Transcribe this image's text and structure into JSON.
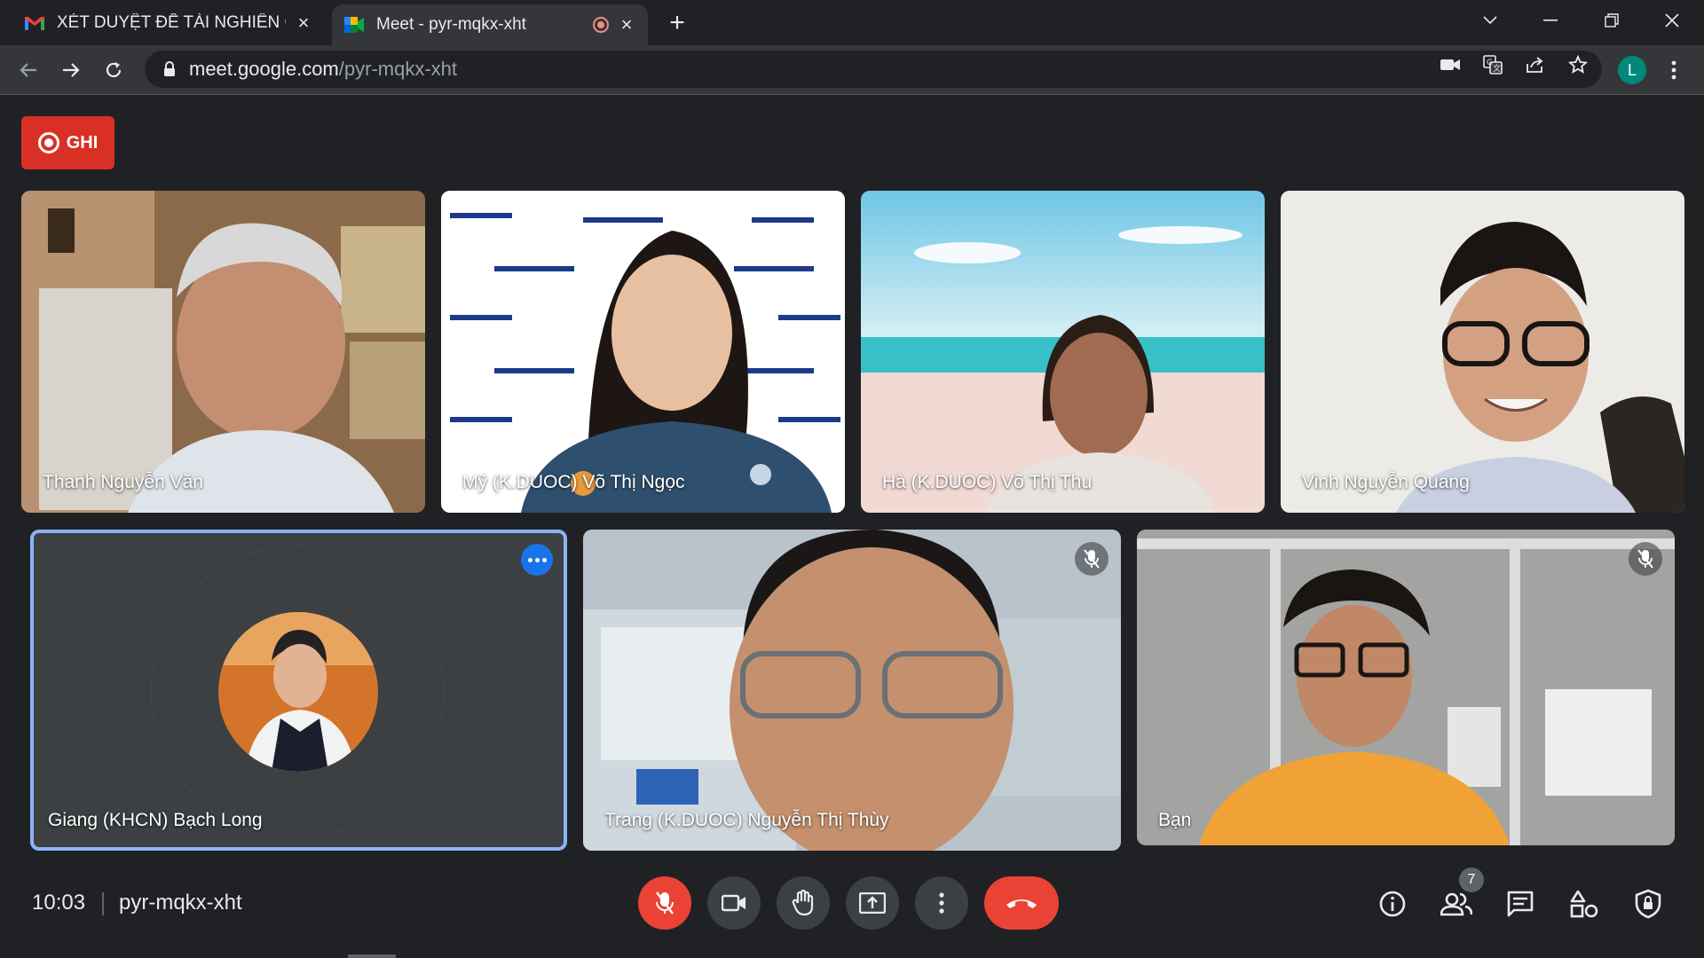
{
  "browser": {
    "tabs": [
      {
        "title": "XÉT DUYỆT ĐỀ TÀI NGHIÊN CỨU",
        "icon": "gmail-icon",
        "active": false
      },
      {
        "title": "Meet - pyr-mqkx-xht",
        "icon": "meet-icon",
        "active": true,
        "recording": true
      }
    ],
    "url_host": "meet.google.com",
    "url_path": "/pyr-mqkx-xht",
    "profile_initial": "L"
  },
  "meet": {
    "recording_label": "GHI",
    "participants": [
      {
        "name": "Thanh Nguyễn Văn",
        "muted": false
      },
      {
        "name": "Mỹ (K.DUOC) Võ Thị Ngọc",
        "muted": false
      },
      {
        "name": "Hà (K.DUOC) Võ Thị Thu",
        "muted": false
      },
      {
        "name": "Vinh Nguyễn Quang",
        "muted": false
      },
      {
        "name": "Giang (KHCN) Bạch Long",
        "muted": false,
        "speaking": true
      },
      {
        "name": "Trang (K.DUOC) Nguyễn Thị Thùy",
        "muted": true
      },
      {
        "name": "Bạn",
        "muted": true
      }
    ],
    "time": "10:03",
    "meeting_code": "pyr-mqkx-xht",
    "people_count": "7"
  },
  "colors": {
    "record_red": "#d93025",
    "end_call_red": "#ea4335",
    "speaking_border": "#8ab4f8",
    "accent_blue": "#1a73e8"
  }
}
